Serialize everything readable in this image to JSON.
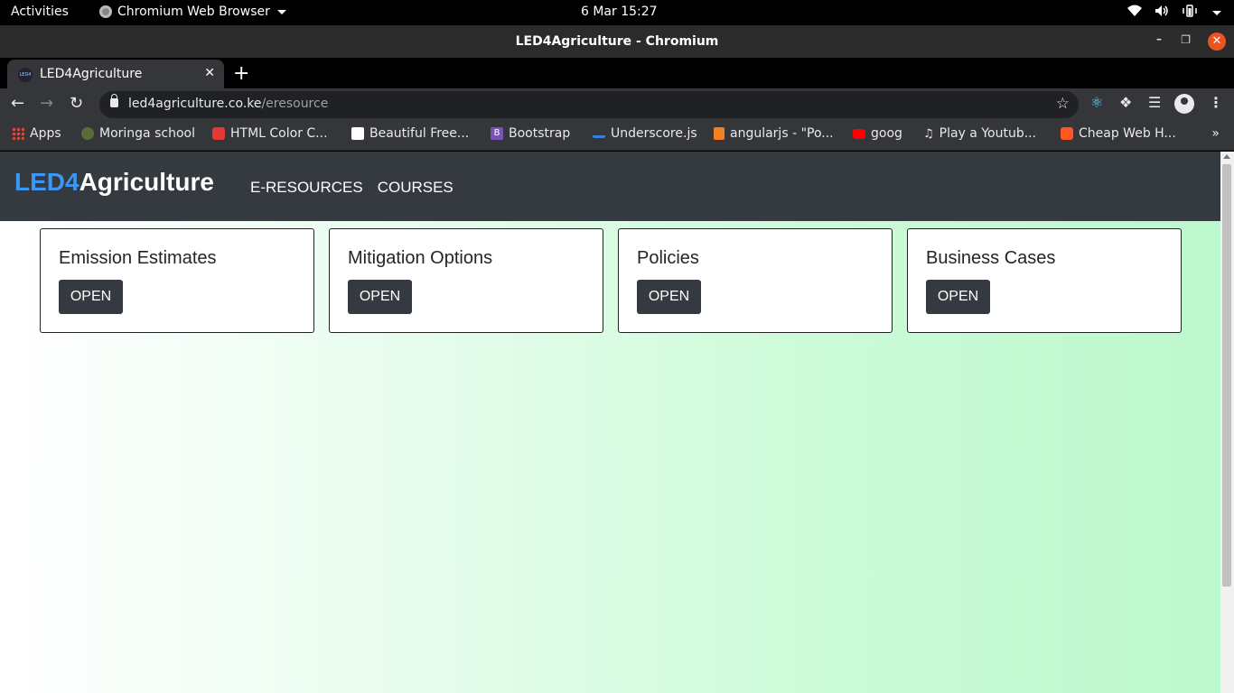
{
  "system": {
    "activities": "Activities",
    "app_name": "Chromium Web Browser",
    "clock": "6 Mar  15:27"
  },
  "window": {
    "title": "LED4Agriculture - Chromium"
  },
  "tabs": [
    {
      "title": "LED4Agriculture",
      "favicon_text": "LED4"
    }
  ],
  "address_bar": {
    "host": "led4agriculture.co.ke",
    "path": "/eresource"
  },
  "bookmarks": [
    {
      "label": "Apps",
      "icon": "apps-grid-icon",
      "color": "#ea4335"
    },
    {
      "label": "Moringa school",
      "icon": "moringa-icon",
      "color": "#5a6b3a"
    },
    {
      "label": "HTML Color C...",
      "icon": "color-picker-icon",
      "color": "#e53935"
    },
    {
      "label": "Beautiful Free...",
      "icon": "unsplash-icon",
      "color": "#ffffff"
    },
    {
      "label": "Bootstrap",
      "icon": "bootstrap-icon",
      "color": "#7952b3"
    },
    {
      "label": "Underscore.js",
      "icon": "underscore-icon",
      "color": "#3b7dd8"
    },
    {
      "label": "angularjs - \"Po...",
      "icon": "stackoverflow-icon",
      "color": "#f48024"
    },
    {
      "label": "goog",
      "icon": "youtube-icon",
      "color": "#ff0000"
    },
    {
      "label": "Play a Youtub...",
      "icon": "music-note-icon",
      "color": "#e8eaed"
    },
    {
      "label": "Cheap Web H...",
      "icon": "hosting-icon",
      "color": "#ff5722"
    }
  ],
  "site": {
    "brand_part1": "LED4",
    "brand_part2": "Agriculture",
    "nav": [
      "E-RESOURCES",
      "COURSES"
    ],
    "cards": [
      {
        "title": "Emission Estimates",
        "button": "OPEN"
      },
      {
        "title": "Mitigation Options",
        "button": "OPEN"
      },
      {
        "title": "Policies",
        "button": "OPEN"
      },
      {
        "title": "Business Cases",
        "button": "OPEN"
      }
    ]
  },
  "colors": {
    "navbar_bg": "#343a40",
    "brand_accent": "#3b97f6",
    "button_bg": "#343a40",
    "page_gradient_end": "#bdf8cd"
  }
}
